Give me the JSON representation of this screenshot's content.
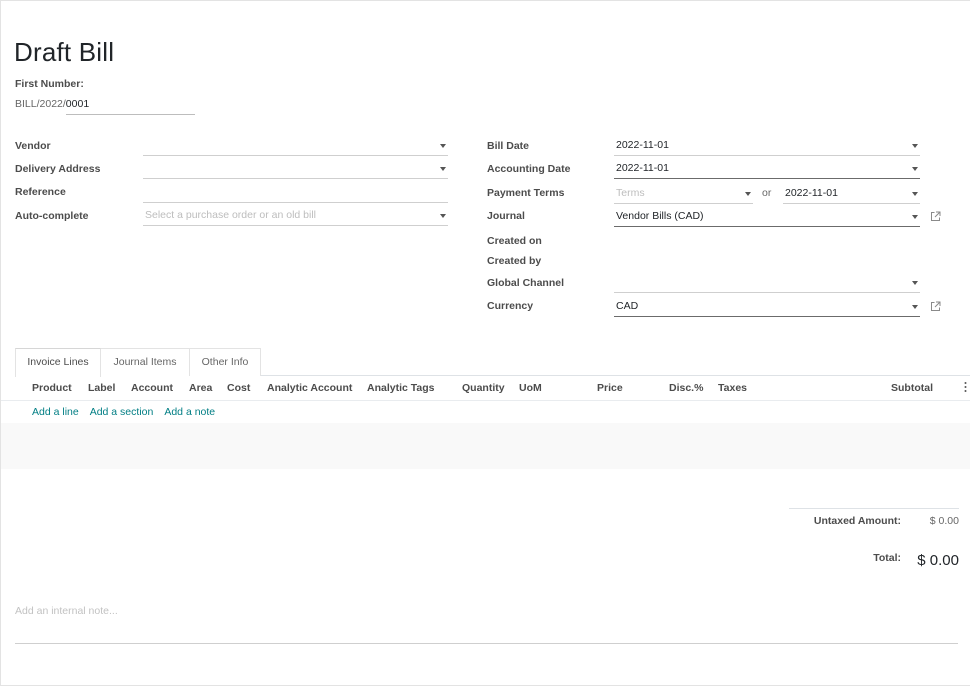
{
  "form": {
    "title": "Draft Bill",
    "first_number_label": "First Number:",
    "first_number_prefix": "BILL/2022/",
    "first_number_seq": "0001"
  },
  "left_fields": {
    "vendor_label": "Vendor",
    "vendor_value": "",
    "delivery_label": "Delivery Address",
    "delivery_value": "",
    "reference_label": "Reference",
    "reference_value": "",
    "autocomplete_label": "Auto-complete",
    "autocomplete_placeholder": "Select a purchase order or an old bill"
  },
  "right_fields": {
    "bill_date_label": "Bill Date",
    "bill_date_value": "2022-11-01",
    "accounting_date_label": "Accounting Date",
    "accounting_date_value": "2022-11-01",
    "payment_terms_label": "Payment Terms",
    "payment_terms_placeholder": "Terms",
    "or_text": "or",
    "due_date_value": "2022-11-01",
    "journal_label": "Journal",
    "journal_value": "Vendor Bills (CAD)",
    "created_on_label": "Created on",
    "created_by_label": "Created by",
    "global_channel_label": "Global Channel",
    "global_channel_value": "",
    "currency_label": "Currency",
    "currency_value": "CAD"
  },
  "tabs": [
    {
      "label": "Invoice Lines",
      "active": true
    },
    {
      "label": "Journal Items",
      "active": false
    },
    {
      "label": "Other Info",
      "active": false
    }
  ],
  "table": {
    "columns": [
      "Product",
      "Label",
      "Account",
      "Area",
      "Cost",
      "Analytic Account",
      "Analytic Tags",
      "Quantity",
      "UoM",
      "Price",
      "Disc.%",
      "Taxes",
      "Subtotal"
    ],
    "add_line": "Add a line",
    "add_section": "Add a section",
    "add_note": "Add a note"
  },
  "totals": {
    "untaxed_label": "Untaxed Amount:",
    "untaxed_value": "$ 0.00",
    "total_label": "Total:",
    "total_value": "$ 0.00"
  },
  "note_placeholder": "Add an internal note...",
  "colors": {
    "link": "#017e84",
    "text": "#4c4c4c"
  },
  "icons": {
    "dropdown": "caret-down-icon",
    "external": "external-link-icon",
    "column_options": "vertical-dots-icon"
  }
}
